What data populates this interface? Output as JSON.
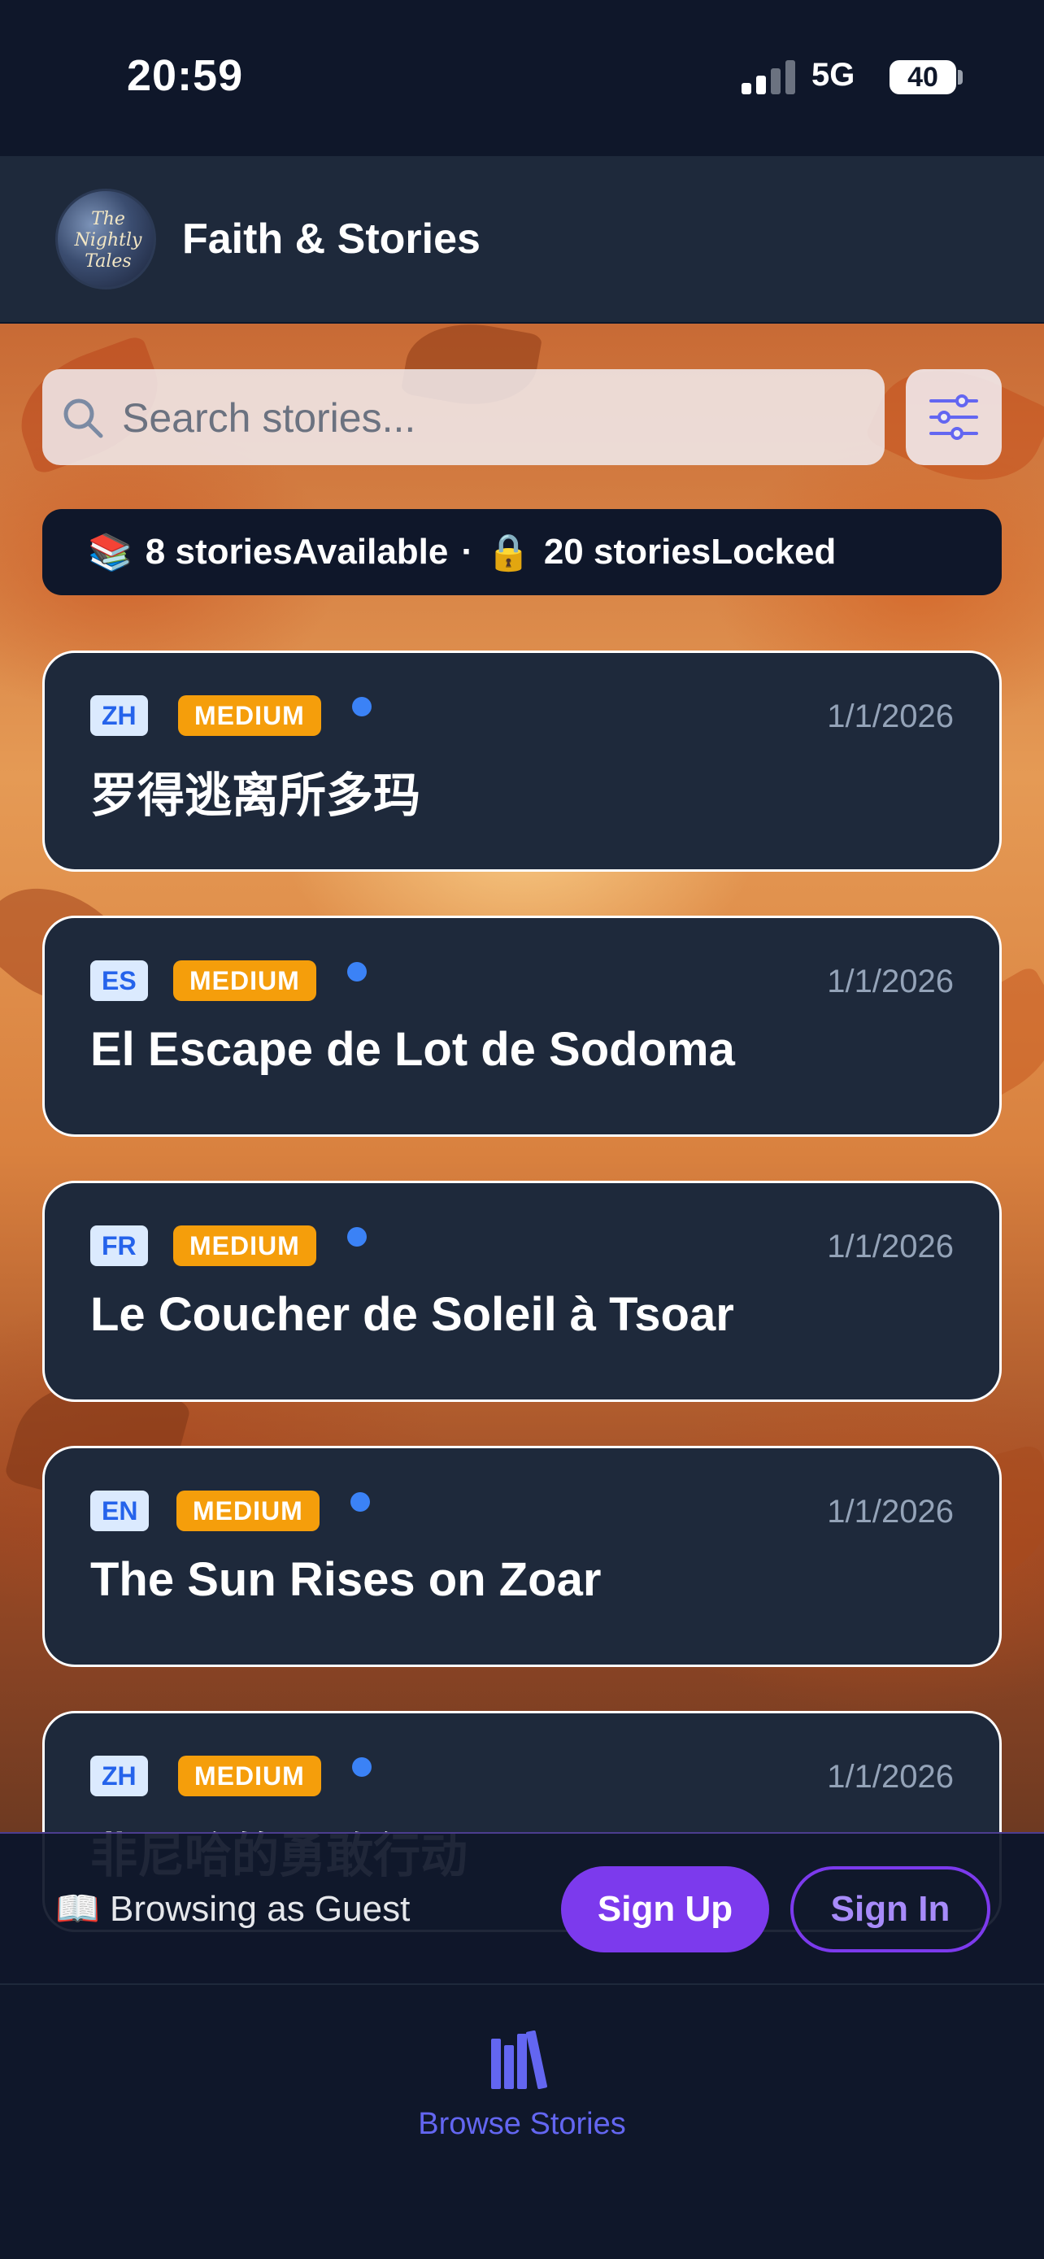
{
  "status_bar": {
    "time": "20:59",
    "network": "5G",
    "battery": "40"
  },
  "header": {
    "logo_text": "The Nightly Tales",
    "title": "Faith & Stories"
  },
  "search": {
    "placeholder": "Search stories..."
  },
  "stats": {
    "available_emoji": "📚",
    "available_text": "8 storiesAvailable",
    "separator": "·",
    "locked_emoji": "🔒",
    "locked_text": "20 storiesLocked"
  },
  "stories": [
    {
      "lang": "ZH",
      "difficulty": "MEDIUM",
      "date": "1/1/2026",
      "title": "罗得逃离所多玛"
    },
    {
      "lang": "ES",
      "difficulty": "MEDIUM",
      "date": "1/1/2026",
      "title": "El Escape de Lot de Sodoma"
    },
    {
      "lang": "FR",
      "difficulty": "MEDIUM",
      "date": "1/1/2026",
      "title": "Le Coucher de Soleil à Tsoar"
    },
    {
      "lang": "EN",
      "difficulty": "MEDIUM",
      "date": "1/1/2026",
      "title": "The Sun Rises on Zoar"
    },
    {
      "lang": "ZH",
      "difficulty": "MEDIUM",
      "date": "1/1/2026",
      "title": "非尼哈的勇敢行动"
    }
  ],
  "guest_bar": {
    "emoji": "📖",
    "label": "Browsing as Guest",
    "sign_up": "Sign Up",
    "sign_in": "Sign In"
  },
  "tab_bar": {
    "browse_label": "Browse Stories"
  },
  "colors": {
    "accent": "#7c3aed",
    "tab_active": "#6366f1",
    "card_bg": "#1e293b",
    "difficulty_medium": "#f59e0b",
    "lang_badge_bg": "#dbeafe",
    "new_dot": "#3b82f6"
  }
}
